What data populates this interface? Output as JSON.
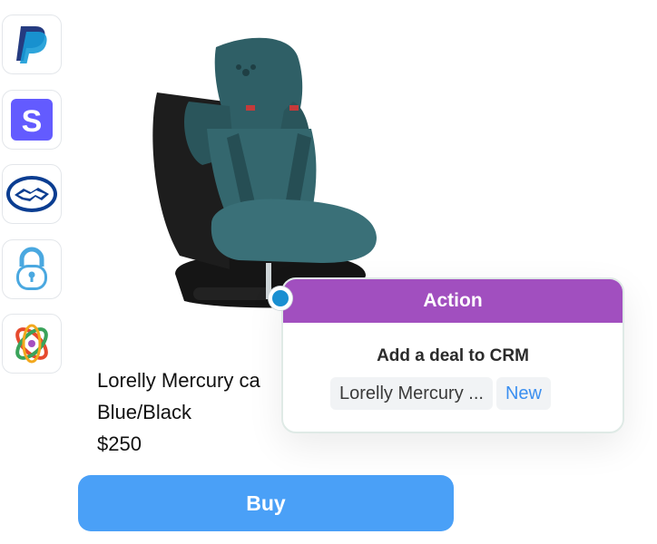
{
  "sidebar": {
    "apps": [
      {
        "name": "paypal",
        "icon": "paypal-icon",
        "color": "#253b80"
      },
      {
        "name": "stripe",
        "icon": "stripe-icon",
        "color": "#635bff"
      },
      {
        "name": "mercado-pago",
        "icon": "handshake-icon",
        "color": "#0a3d91"
      },
      {
        "name": "lock-app",
        "icon": "lock-icon",
        "color": "#4aa8e0"
      },
      {
        "name": "atom-app",
        "icon": "atom-icon",
        "color": "#e64a2e"
      }
    ]
  },
  "product": {
    "name": "Lorelly Mercury ca",
    "variant": "Blue/Black",
    "price": "$250",
    "image_icon": "car-seat-image",
    "seat_color": "#2f5f66"
  },
  "buy_button": {
    "label": "Buy",
    "color": "#4aa0f7"
  },
  "action_card": {
    "header": "Action",
    "header_color": "#a14fbf",
    "subtitle": "Add a deal to CRM",
    "chip_label": "Lorelly Mercury  ...",
    "chip_new": "New"
  }
}
